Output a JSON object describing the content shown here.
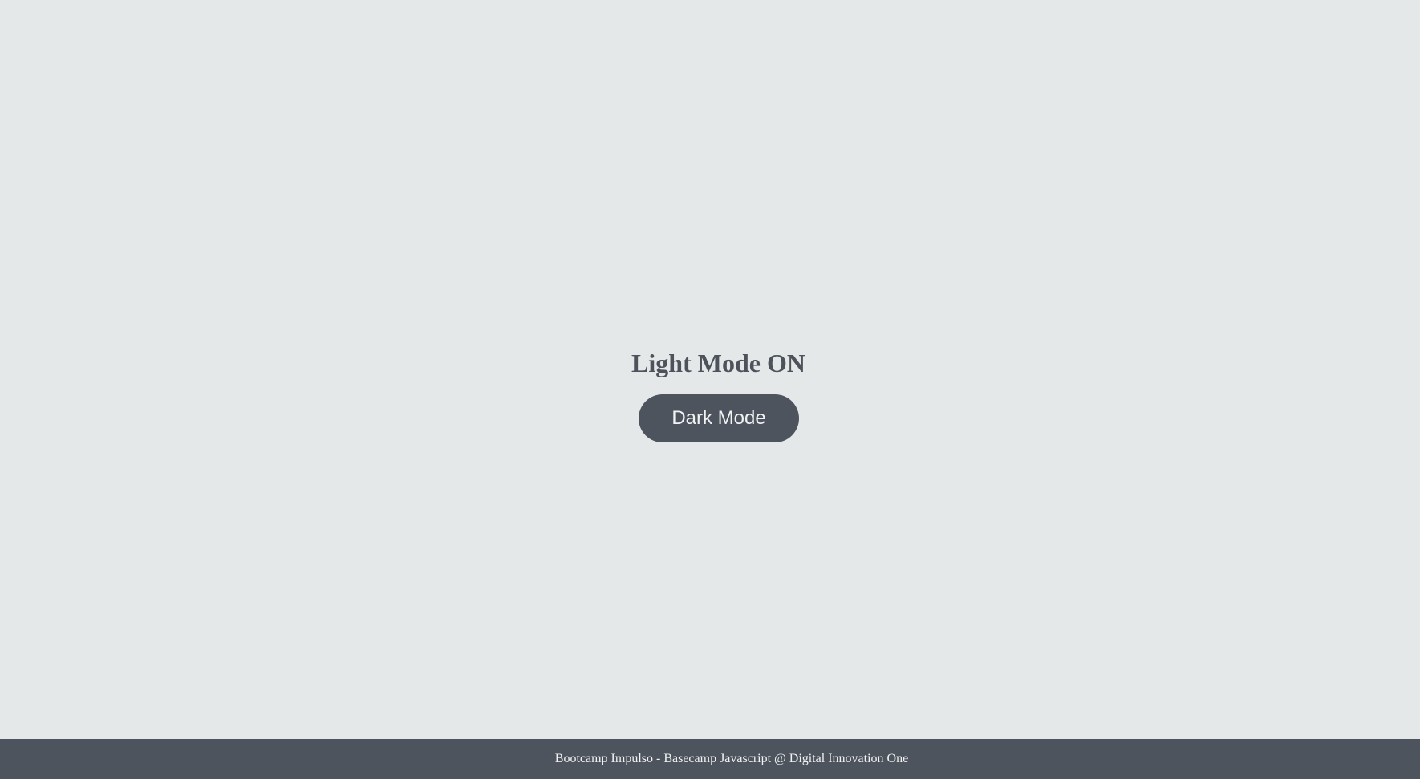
{
  "main": {
    "title": "Light Mode ON",
    "button_label": "Dark Mode"
  },
  "footer": {
    "text": "Bootcamp Impulso - Basecamp Javascript @ Digital Innovation One"
  },
  "colors": {
    "background": "#e4e8e9",
    "text": "#4e535b",
    "button_bg": "#4e545d",
    "button_text": "#f0f2f3",
    "footer_bg": "#4e545d"
  }
}
